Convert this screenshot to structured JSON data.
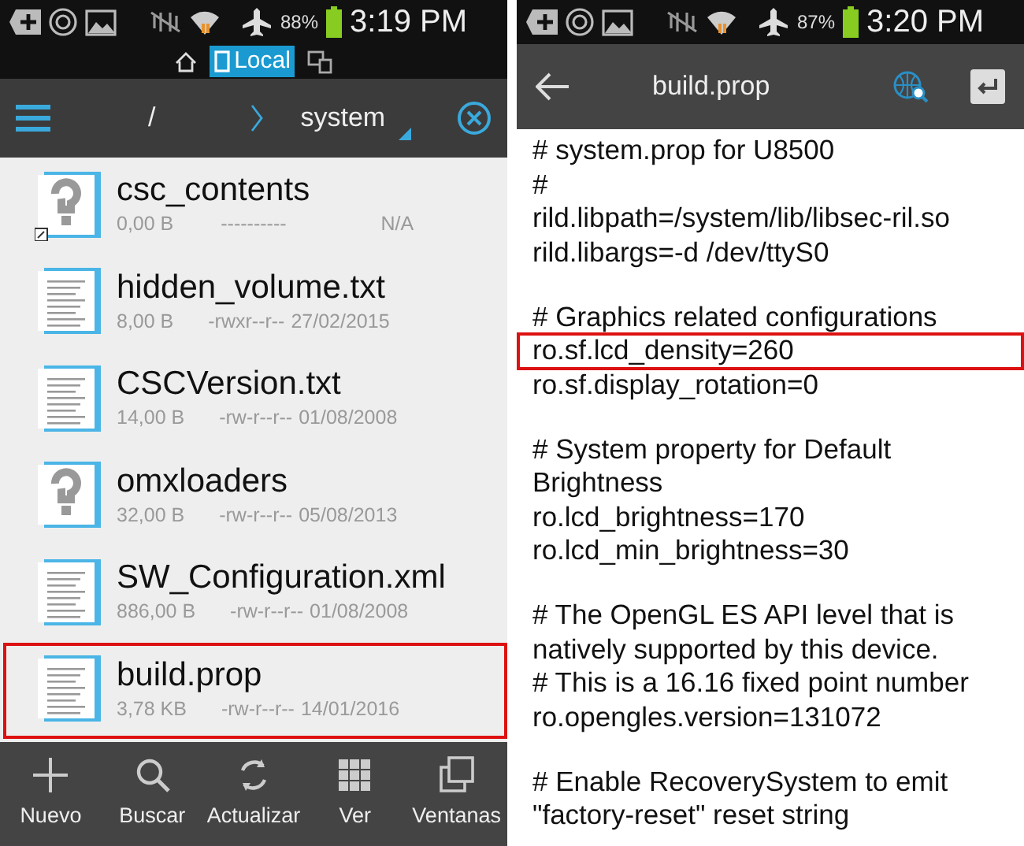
{
  "left_screen": {
    "status_bar": {
      "battery": "88%",
      "time": "3:19 PM"
    },
    "location_tabs": [
      {
        "label": "Local",
        "selected": true
      }
    ],
    "toolbar": {
      "breadcrumbs": [
        {
          "label": "/"
        },
        {
          "label": "system"
        }
      ]
    },
    "files": [
      {
        "name": "csc_contents",
        "size": "0,00 B",
        "permissions": "----------",
        "date": "N/A",
        "kind": "unknown",
        "shortcut": true,
        "highlighted": false
      },
      {
        "name": "hidden_volume.txt",
        "size": "8,00 B",
        "permissions": "-rwxr--r--",
        "date": "27/02/2015",
        "kind": "text",
        "shortcut": false,
        "highlighted": false
      },
      {
        "name": "CSCVersion.txt",
        "size": "14,00 B",
        "permissions": "-rw-r--r--",
        "date": "01/08/2008",
        "kind": "text",
        "shortcut": false,
        "highlighted": false
      },
      {
        "name": "omxloaders",
        "size": "32,00 B",
        "permissions": "-rw-r--r--",
        "date": "05/08/2013",
        "kind": "unknown",
        "shortcut": false,
        "highlighted": false
      },
      {
        "name": "SW_Configuration.xml",
        "size": "886,00 B",
        "permissions": "-rw-r--r--",
        "date": "01/08/2008",
        "kind": "text",
        "shortcut": false,
        "highlighted": false
      },
      {
        "name": "build.prop",
        "size": "3,78 KB",
        "permissions": "-rw-r--r--",
        "date": "14/01/2016",
        "kind": "text",
        "shortcut": false,
        "highlighted": true
      }
    ],
    "bottom_bar": [
      {
        "label": "Nuevo",
        "kind": "plus"
      },
      {
        "label": "Buscar",
        "kind": "search"
      },
      {
        "label": "Actualizar",
        "kind": "refresh"
      },
      {
        "label": "Ver",
        "kind": "grid"
      },
      {
        "label": "Ventanas",
        "kind": "windows"
      }
    ]
  },
  "right_screen": {
    "status_bar": {
      "battery": "87%",
      "time": "3:20 PM"
    },
    "action_bar": {
      "title": "build.prop"
    },
    "paragraphs": [
      {
        "lines": [
          {
            "text": "# system.prop for U8500",
            "highlighted": false
          },
          {
            "text": "#",
            "highlighted": false
          },
          {
            "text": "rild.libpath=/system/lib/libsec-ril.so",
            "highlighted": false
          },
          {
            "text": "rild.libargs=-d /dev/ttyS0",
            "highlighted": false
          }
        ]
      },
      {
        "lines": [
          {
            "text": "# Graphics related configurations",
            "highlighted": false
          },
          {
            "text": "ro.sf.lcd_density=260",
            "highlighted": true
          },
          {
            "text": "ro.sf.display_rotation=0",
            "highlighted": false
          }
        ]
      },
      {
        "lines": [
          {
            "text": "# System property for Default",
            "highlighted": false
          },
          {
            "text": "Brightness",
            "highlighted": false
          },
          {
            "text": "ro.lcd_brightness=170",
            "highlighted": false
          },
          {
            "text": "ro.lcd_min_brightness=30",
            "highlighted": false
          }
        ]
      },
      {
        "lines": [
          {
            "text": "# The OpenGL ES API level that is",
            "highlighted": false
          },
          {
            "text": "natively supported by this device.",
            "highlighted": false
          },
          {
            "text": "# This is a 16.16 fixed point number",
            "highlighted": false
          },
          {
            "text": "ro.opengles.version=131072",
            "highlighted": false
          }
        ]
      },
      {
        "lines": [
          {
            "text": "# Enable RecoverySystem to emit",
            "highlighted": false
          },
          {
            "text": "\"factory-reset\" reset string",
            "highlighted": false
          }
        ]
      }
    ]
  }
}
